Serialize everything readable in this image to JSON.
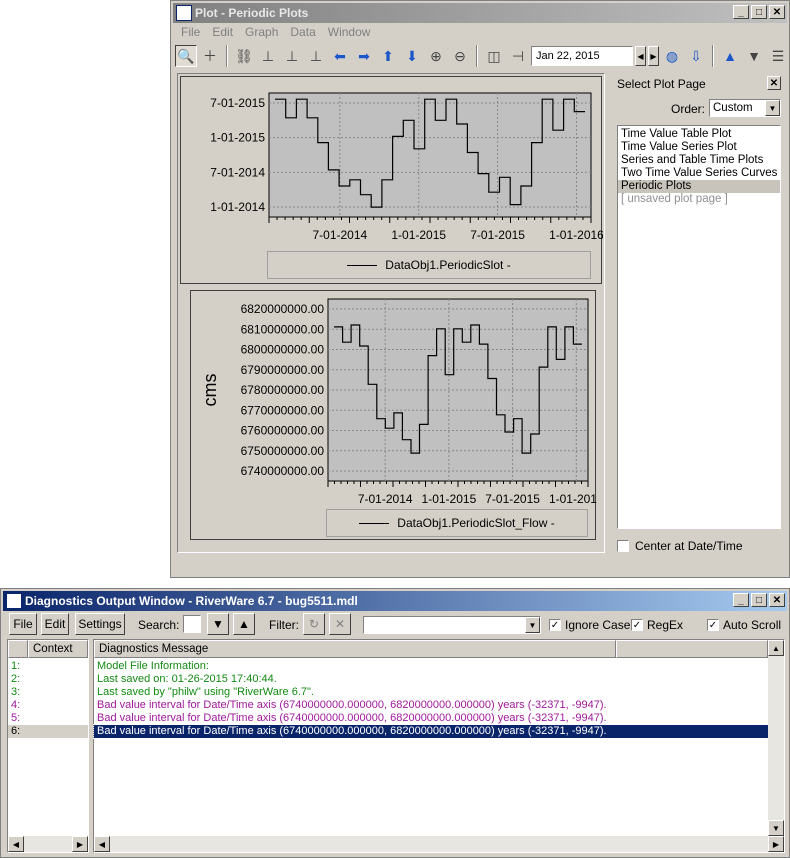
{
  "plot_window": {
    "title": "Plot - Periodic Plots",
    "menu": [
      "File",
      "Edit",
      "Graph",
      "Data",
      "Window"
    ],
    "date": "Jan 22, 2015",
    "select_plot_page_label": "Select Plot Page",
    "order_label": "Order:",
    "order_value": "Custom",
    "plot_pages": [
      "Time Value Table Plot",
      "Time Value Series Plot",
      "Series and Table Time Plots",
      "Two Time Value Series Curves",
      "Periodic Plots",
      "[ unsaved plot page ]"
    ],
    "center_at_label": "Center at Date/Time"
  },
  "chart_data": [
    {
      "type": "line",
      "title": "",
      "xlabel": "",
      "ylabel": "",
      "x_tick_labels": [
        "7-01-2014",
        "1-01-2015",
        "7-01-2015",
        "1-01-2016"
      ],
      "y_tick_labels": [
        "7-01-2015",
        "1-01-2015",
        "7-01-2014",
        "1-01-2014"
      ],
      "legend": [
        "DataObj1.PeriodicSlot -"
      ],
      "grid": true,
      "series": [
        {
          "name": "DataObj1.PeriodicSlot -",
          "step_levels": [
            0.95,
            0.8,
            0.95,
            0.8,
            0.6,
            0.38,
            0.25,
            0.3,
            0.18,
            0.08,
            0.3,
            0.65,
            0.78,
            0.55,
            0.95,
            0.78,
            0.95,
            0.75,
            0.52,
            0.35,
            0.2,
            0.32,
            0.1,
            0.25,
            0.6,
            0.95,
            0.7,
            0.95,
            0.85
          ]
        }
      ]
    },
    {
      "type": "line",
      "title": "",
      "xlabel": "",
      "ylabel": "cms",
      "x_tick_labels": [
        "7-01-2014",
        "1-01-2015",
        "7-01-2015",
        "1-01-2016"
      ],
      "y_tick_labels": [
        "6820000000.00",
        "6810000000.00",
        "6800000000.00",
        "6790000000.00",
        "6780000000.00",
        "6770000000.00",
        "6760000000.00",
        "6750000000.00",
        "6740000000.00"
      ],
      "ylim": [
        6740000000,
        6820000000
      ],
      "legend": [
        "DataObj1.PeriodicSlot_Flow -"
      ],
      "grid": true,
      "series": [
        {
          "name": "DataObj1.PeriodicSlot_Flow -",
          "values": [
            6813000000,
            6805000000,
            6814000000,
            6803000000,
            6783000000,
            6765000000,
            6760000000,
            6768000000,
            6754000000,
            6747000000,
            6762000000,
            6798000000,
            6812000000,
            6788000000,
            6812000000,
            6805000000,
            6814000000,
            6804000000,
            6786000000,
            6767000000,
            6758000000,
            6765000000,
            6747000000,
            6757000000,
            6792000000,
            6813000000,
            6796000000,
            6813000000,
            6804000000
          ]
        }
      ]
    }
  ],
  "diag_window": {
    "title": "Diagnostics Output Window - RiverWare 6.7 - bug5511.mdl",
    "buttons": {
      "file": "File",
      "edit": "Edit",
      "settings": "Settings"
    },
    "search_label": "Search:",
    "filter_label": "Filter:",
    "ignore_case": "Ignore Case",
    "regex": "RegEx",
    "auto_scroll": "Auto Scroll",
    "context_header": "Context",
    "message_header": "Diagnostics Message",
    "rows": [
      {
        "ctx": "1:",
        "msg": "Model File Information:",
        "kind": "g"
      },
      {
        "ctx": "2:",
        "msg": "Last saved on: 01-26-2015 17:40:44.",
        "kind": "g"
      },
      {
        "ctx": "3:",
        "msg": "Last saved by \"philw\" using \"RiverWare 6.7\".",
        "kind": "g"
      },
      {
        "ctx": "4:",
        "msg": "Bad value interval for Date/Time axis (6740000000.000000, 6820000000.000000) years (-32371, -9947).",
        "kind": "m"
      },
      {
        "ctx": "5:",
        "msg": "Bad value interval for Date/Time axis (6740000000.000000, 6820000000.000000) years (-32371, -9947).",
        "kind": "m"
      },
      {
        "ctx": "6:",
        "msg": "Bad value interval for Date/Time axis (6740000000.000000, 6820000000.000000) years (-32371, -9947).",
        "kind": "sel"
      }
    ]
  }
}
